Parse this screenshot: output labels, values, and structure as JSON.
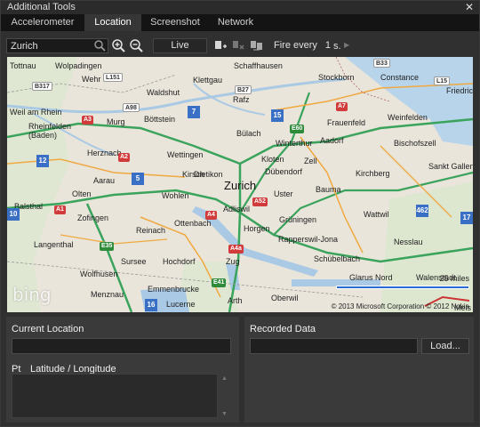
{
  "window": {
    "title": "Additional Tools",
    "close_glyph": "✕"
  },
  "tabs": [
    {
      "label": "Accelerometer",
      "active": false
    },
    {
      "label": "Location",
      "active": true
    },
    {
      "label": "Screenshot",
      "active": false
    },
    {
      "label": "Network",
      "active": false
    }
  ],
  "toolbar": {
    "search_value": "Zurich",
    "search_icon": "search-icon",
    "zoom_in_icon": "zoom-in-icon",
    "zoom_out_icon": "zoom-out-icon",
    "live_label": "Live",
    "add_pin_icon": "add-pin-icon",
    "clear_pins_icon": "clear-pins-icon",
    "route_icon": "route-icon",
    "fire_label": "Fire every",
    "fire_value": "1",
    "fire_unit": "s.",
    "play_glyph": "▶"
  },
  "map": {
    "places": [
      {
        "name": "Waldshut",
        "big": false
      },
      {
        "name": "Weil am Rhein",
        "big": false
      },
      {
        "name": "Rheinfelden (Baden)",
        "big": false
      },
      {
        "name": "Murg",
        "big": false
      },
      {
        "name": "Böttstein",
        "big": false
      },
      {
        "name": "Bülach",
        "big": false
      },
      {
        "name": "Winterthur",
        "big": false
      },
      {
        "name": "Frauenfeld",
        "big": false
      },
      {
        "name": "Weinfelden",
        "big": false
      },
      {
        "name": "Aadorf",
        "big": false
      },
      {
        "name": "Bischofszell",
        "big": false
      },
      {
        "name": "Herznach",
        "big": false
      },
      {
        "name": "Aarau",
        "big": false
      },
      {
        "name": "Wettingen",
        "big": false
      },
      {
        "name": "Dietikon",
        "big": false
      },
      {
        "name": "Dübendorf",
        "big": false
      },
      {
        "name": "Zurich",
        "big": true
      },
      {
        "name": "Uster",
        "big": false
      },
      {
        "name": "Zell",
        "big": false
      },
      {
        "name": "Kirchberg",
        "big": false
      },
      {
        "name": "Sankt Gallen",
        "big": false
      },
      {
        "name": "Olten",
        "big": false
      },
      {
        "name": "Wohlen",
        "big": false
      },
      {
        "name": "Adliswil",
        "big": false
      },
      {
        "name": "Bauma",
        "big": false
      },
      {
        "name": "Wattwil",
        "big": false
      },
      {
        "name": "Balsthal",
        "big": false
      },
      {
        "name": "Zofingen",
        "big": false
      },
      {
        "name": "Grüningen",
        "big": false
      },
      {
        "name": "Horgen",
        "big": false
      },
      {
        "name": "Langenthal",
        "big": false
      },
      {
        "name": "Reinach",
        "big": false
      },
      {
        "name": "Rapperswil-Jona",
        "big": false
      },
      {
        "name": "Nesslau",
        "big": false
      },
      {
        "name": "Sursee",
        "big": false
      },
      {
        "name": "Hochdorf",
        "big": false
      },
      {
        "name": "Zug",
        "big": false
      },
      {
        "name": "Schübelbach",
        "big": false
      },
      {
        "name": "Menznau",
        "big": false
      },
      {
        "name": "Emmenbrucke",
        "big": false
      },
      {
        "name": "Lucerne",
        "big": false
      },
      {
        "name": "Arth",
        "big": false
      },
      {
        "name": "Glarus Nord",
        "big": false
      },
      {
        "name": "Walenstadt",
        "big": false
      },
      {
        "name": "Mels",
        "big": false
      },
      {
        "name": "Schaffhausen",
        "big": false
      },
      {
        "name": "Stockborn",
        "big": false
      },
      {
        "name": "Constance",
        "big": false
      },
      {
        "name": "Friedric",
        "big": false
      },
      {
        "name": "Wolpadingen",
        "big": false
      },
      {
        "name": "Klettgau",
        "big": false
      },
      {
        "name": "Rafz",
        "big": false
      },
      {
        "name": "Kloten",
        "big": false
      },
      {
        "name": "Ottenbach",
        "big": false
      },
      {
        "name": "Wolfhusen",
        "big": false
      },
      {
        "name": "Oberwil",
        "big": false
      },
      {
        "name": "Kirsch",
        "big": false
      },
      {
        "name": "Wehr",
        "big": false
      },
      {
        "name": "Tottnau",
        "big": false
      }
    ],
    "roads": [
      "A3",
      "A98",
      "L151",
      "B317",
      "B27",
      "E60",
      "A7",
      "A1",
      "A2",
      "A4",
      "A4a",
      "E41",
      "A52",
      "E35",
      "L15",
      "B33"
    ],
    "badges": [
      "7",
      "15",
      "12",
      "5",
      "462",
      "10",
      "16",
      "17"
    ],
    "brand": "bing",
    "scale_label": "25 miles",
    "copyright": "© 2013 Microsoft Corporation   © 2012 Nokia"
  },
  "current_location": {
    "title": "Current Location",
    "value": "",
    "col_pt": "Pt",
    "col_latlon": "Latitude / Longitude",
    "scroll_up_glyph": "▲",
    "scroll_down_glyph": "▼"
  },
  "recorded": {
    "title": "Recorded Data",
    "value": "",
    "load_label": "Load..."
  }
}
